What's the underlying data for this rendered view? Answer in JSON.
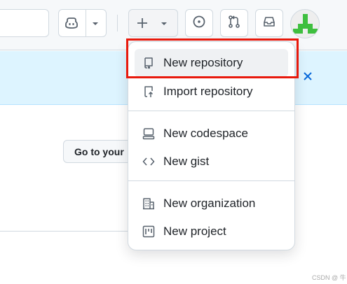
{
  "header": {
    "icons": [
      "copilot-icon",
      "chevron-down-icon",
      "plus-icon",
      "chevron-down-icon",
      "issue-icon",
      "pull-request-icon",
      "inbox-icon"
    ]
  },
  "banner": {
    "close_icon": "x-icon"
  },
  "main": {
    "goto_button_label": "Go to your"
  },
  "dropdown": {
    "items": [
      {
        "label": "New repository",
        "icon": "repo-icon"
      },
      {
        "label": "Import repository",
        "icon": "repo-push-icon"
      },
      {
        "label": "New codespace",
        "icon": "codespaces-icon"
      },
      {
        "label": "New gist",
        "icon": "code-icon"
      },
      {
        "label": "New organization",
        "icon": "organization-icon"
      },
      {
        "label": "New project",
        "icon": "project-icon"
      }
    ]
  },
  "annotation": {
    "color": "#e8190c"
  },
  "watermark": "CSDN @ 牛"
}
